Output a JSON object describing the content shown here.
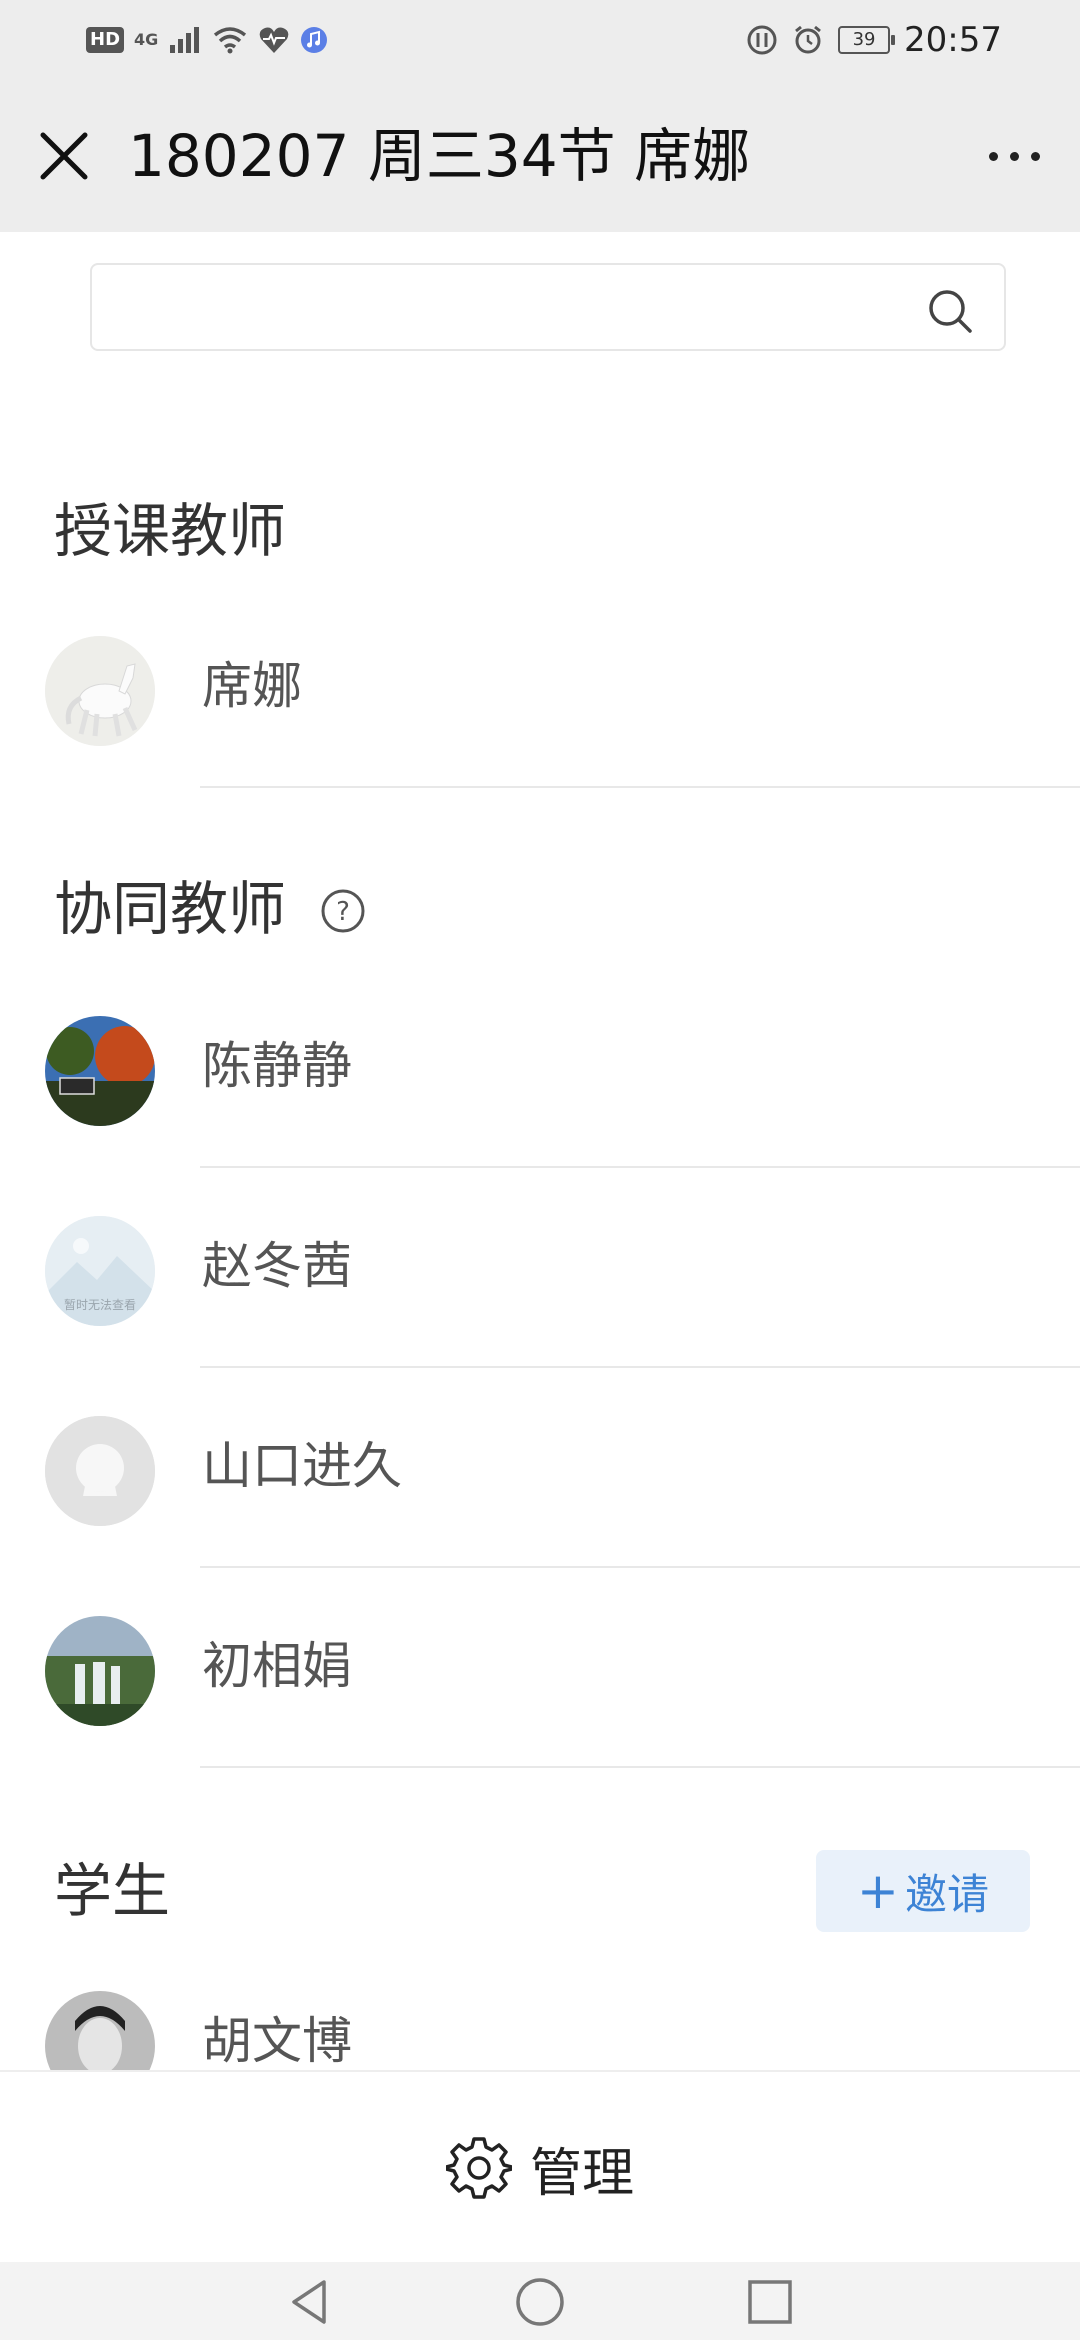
{
  "status_bar": {
    "hd": "HD",
    "network": "4G",
    "battery": "39",
    "time": "20:57"
  },
  "header": {
    "title": "180207 周三34节 席娜"
  },
  "search": {
    "placeholder": ""
  },
  "sections": {
    "teacher": {
      "title": "授课教师",
      "people": [
        {
          "name": "席娜"
        }
      ]
    },
    "co_teachers": {
      "title": "协同教师",
      "help_symbol": "?",
      "people": [
        {
          "name": "陈静静"
        },
        {
          "name": "赵冬茜",
          "avatar_caption": "暂时无法查看"
        },
        {
          "name": "山口进久"
        },
        {
          "name": "初相娟"
        }
      ]
    },
    "students": {
      "title": "学生",
      "invite_label": "邀请",
      "people": [
        {
          "name": "胡文博"
        }
      ]
    }
  },
  "footer": {
    "manage_label": "管理"
  },
  "colors": {
    "accent": "#3d83d5",
    "header_bg": "#ededed"
  }
}
